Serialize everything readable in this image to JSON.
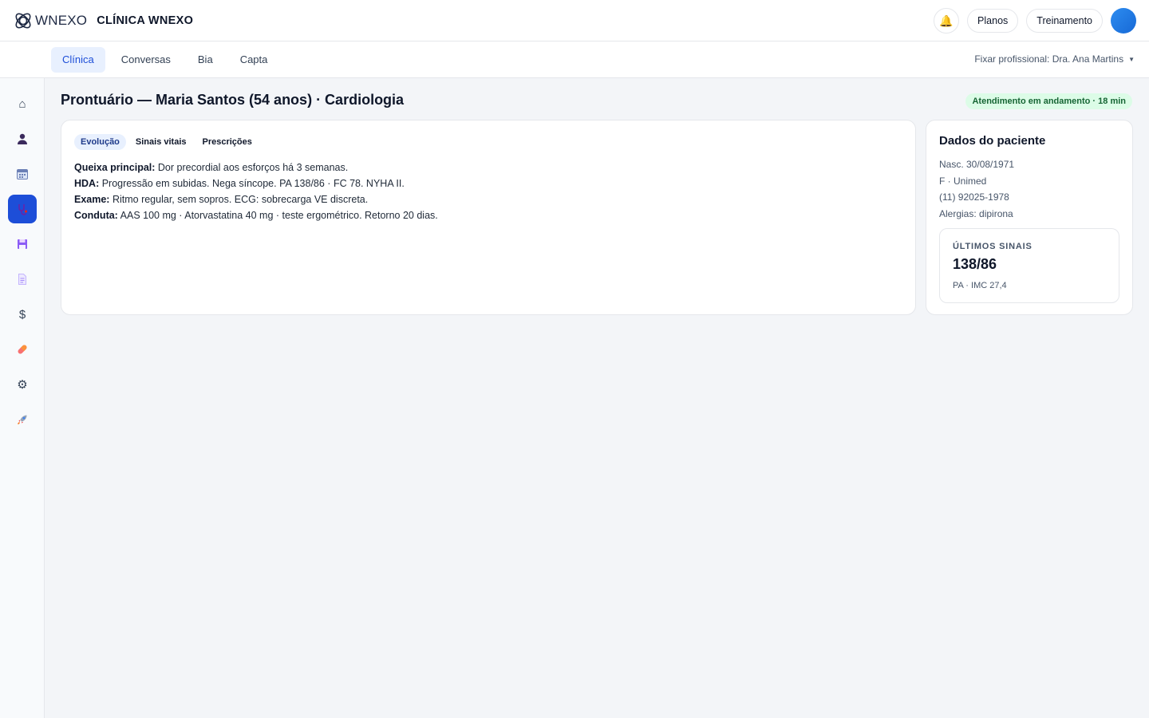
{
  "brand": {
    "logo_icon": "infinity-knot-icon",
    "wordmark": "WNEXO",
    "clinic_name": "CLÍNICA WNEXO"
  },
  "topbar": {
    "bell_icon": "bell-icon",
    "plans_label": "Planos",
    "training_label": "Treinamento"
  },
  "subnav": {
    "tabs": [
      {
        "label": "Clínica",
        "active": true
      },
      {
        "label": "Conversas",
        "active": false
      },
      {
        "label": "Bia",
        "active": false
      },
      {
        "label": "Capta",
        "active": false
      }
    ],
    "fix_professional": "Fixar profissional: Dra. Ana Martins"
  },
  "sidebar": {
    "items": [
      {
        "icon": "home-icon",
        "glyph": "⌂"
      },
      {
        "icon": "user-icon",
        "glyph": "👤"
      },
      {
        "icon": "calendar-icon",
        "glyph": "📅"
      },
      {
        "icon": "stethoscope-icon",
        "glyph": "⚕",
        "active": true
      },
      {
        "icon": "save-icon",
        "glyph": "💾"
      },
      {
        "icon": "document-icon",
        "glyph": "📄"
      },
      {
        "icon": "dollar-icon",
        "glyph": "$"
      },
      {
        "icon": "pill-icon",
        "glyph": "💊"
      },
      {
        "icon": "gear-icon",
        "glyph": "⚙"
      },
      {
        "icon": "rocket-icon",
        "glyph": "🚀"
      }
    ]
  },
  "page": {
    "title": "Prontuário — Maria Santos (54 anos) · Cardiologia",
    "status": "Atendimento em andamento · 18 min"
  },
  "record": {
    "tabs": [
      {
        "label": "Evolução",
        "active": true
      },
      {
        "label": "Sinais vitais",
        "active": false
      },
      {
        "label": "Prescrições",
        "active": false
      }
    ],
    "notes": [
      {
        "key": "Queixa principal:",
        "value": " Dor precordial aos esforços há 3 semanas."
      },
      {
        "key": "HDA:",
        "value": " Progressão em subidas. Nega síncope. PA 138/86 · FC 78. NYHA II."
      },
      {
        "key": "Exame:",
        "value": " Ritmo regular, sem sopros. ECG: sobrecarga VE discreta."
      },
      {
        "key": "Conduta:",
        "value": " AAS 100 mg · Atorvastatina 40 mg · teste ergométrico. Retorno 20 dias."
      }
    ]
  },
  "patient": {
    "title": "Dados do paciente",
    "birth": "Nasc. 30/08/1971",
    "sex_plan": "F · Unimed",
    "phone": "(11) 92025-1978",
    "allergies": "Alergias: dipirona",
    "vitals": {
      "label": "ÚLTIMOS SINAIS",
      "value": "138/86",
      "sub": "PA · IMC 27,4"
    }
  },
  "colors": {
    "accent": "#1d4ed8",
    "status_bg": "#dcfce7",
    "status_fg": "#166534"
  }
}
